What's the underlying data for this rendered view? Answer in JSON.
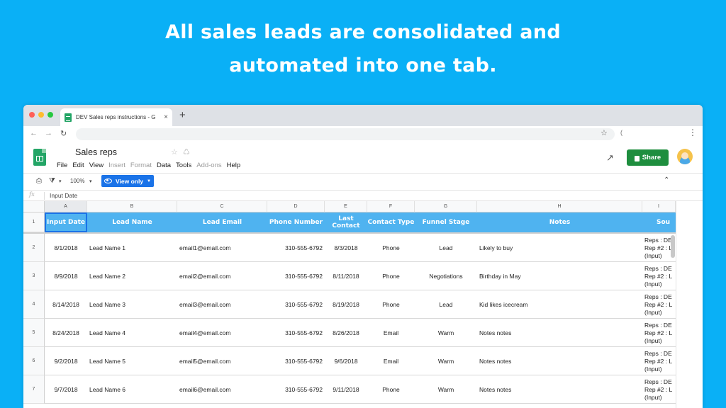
{
  "headline": {
    "line1": "All sales leads are consolidated and",
    "line2": "automated into one tab."
  },
  "browser": {
    "tab_title": "DEV Sales reps instructions - G",
    "tab_close": "×",
    "new_tab": "+",
    "ext_label": "("
  },
  "sheets": {
    "doc_title": "Sales reps",
    "menu": [
      {
        "label": "File",
        "dim": false
      },
      {
        "label": "Edit",
        "dim": false
      },
      {
        "label": "View",
        "dim": false
      },
      {
        "label": "Insert",
        "dim": true
      },
      {
        "label": "Format",
        "dim": true
      },
      {
        "label": "Data",
        "dim": false
      },
      {
        "label": "Tools",
        "dim": false
      },
      {
        "label": "Add-ons",
        "dim": true
      },
      {
        "label": "Help",
        "dim": false
      }
    ],
    "share_label": "Share",
    "zoom": "100%",
    "view_only_label": "View only",
    "formula_symbol": "fx",
    "formula_value": "Input Date"
  },
  "grid": {
    "column_letters": [
      "A",
      "B",
      "C",
      "D",
      "E",
      "F",
      "G",
      "H",
      "I"
    ],
    "header_row_number": "1",
    "headers": [
      "Input Date",
      "Lead Name",
      "Lead Email",
      "Phone Number",
      "Last Contact",
      "Contact Type",
      "Funnel Stage",
      "Notes",
      "Sou"
    ],
    "rows": [
      {
        "num": "2",
        "cells": [
          "8/1/2018",
          "Lead Name 1",
          "email1@email.com",
          "310-555-6792",
          "8/3/2018",
          "Phone",
          "Lead",
          "Likely to buy"
        ],
        "source": [
          "Reps : DE",
          "Rep #2 : L",
          "(Input)"
        ]
      },
      {
        "num": "3",
        "cells": [
          "8/9/2018",
          "Lead Name 2",
          "email2@email.com",
          "310-555-6792",
          "8/11/2018",
          "Phone",
          "Negotiations",
          "Birthday in May"
        ],
        "source": [
          "Reps : DE",
          "Rep #2 : L",
          "(Input)"
        ]
      },
      {
        "num": "4",
        "cells": [
          "8/14/2018",
          "Lead Name 3",
          "email3@email.com",
          "310-555-6792",
          "8/19/2018",
          "Phone",
          "Lead",
          "Kid likes icecream"
        ],
        "source": [
          "Reps : DE",
          "Rep #2 : L",
          "(Input)"
        ]
      },
      {
        "num": "5",
        "cells": [
          "8/24/2018",
          "Lead Name 4",
          "email4@email.com",
          "310-555-6792",
          "8/26/2018",
          "Email",
          "Warm",
          "Notes notes"
        ],
        "source": [
          "Reps : DE",
          "Rep #2 : L",
          "(Input)"
        ]
      },
      {
        "num": "6",
        "cells": [
          "9/2/2018",
          "Lead Name 5",
          "email5@email.com",
          "310-555-6792",
          "9/6/2018",
          "Email",
          "Warm",
          "Notes notes"
        ],
        "source": [
          "Reps : DE",
          "Rep #2 : L",
          "(Input)"
        ]
      },
      {
        "num": "7",
        "cells": [
          "9/7/2018",
          "Lead Name 6",
          "email6@email.com",
          "310-555-6792",
          "9/11/2018",
          "Phone",
          "Warm",
          "Notes notes"
        ],
        "source": [
          "Reps : DE",
          "Rep #2 : L",
          "(Input)"
        ]
      }
    ]
  },
  "colors": {
    "background": "#0ab0f6",
    "header_row": "#4fb3f0",
    "share_button": "#1e8e3e",
    "view_only_button": "#1a73e8"
  }
}
